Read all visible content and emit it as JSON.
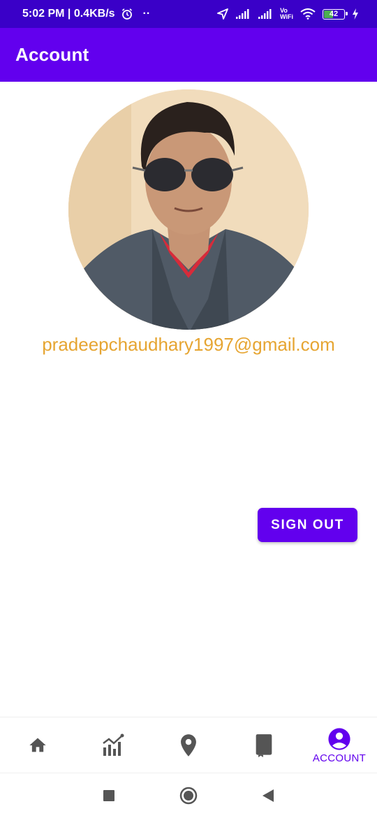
{
  "status_bar": {
    "time_speed": "5:02 PM | 0.4KB/s",
    "dots": "··",
    "battery": "42",
    "icons": [
      "alarm-icon",
      "navigation-icon",
      "signal-icon",
      "signal-icon",
      "vowifi-icon",
      "wifi-icon",
      "battery-icon",
      "charging-icon"
    ],
    "vowifi_label_top": "Vo",
    "vowifi_label_bottom": "WiFi"
  },
  "app_bar": {
    "title": "Account"
  },
  "profile": {
    "email": "pradeepchaudhary1997@gmail.com",
    "avatar_icon": "profile-photo"
  },
  "actions": {
    "sign_out_label": "SIGN OUT"
  },
  "bottom_nav": {
    "items": [
      {
        "icon": "home-icon",
        "label": ""
      },
      {
        "icon": "chart-icon",
        "label": ""
      },
      {
        "icon": "location-pin-icon",
        "label": ""
      },
      {
        "icon": "book-icon",
        "label": ""
      },
      {
        "icon": "account-icon",
        "label": "ACCOUNT",
        "selected": true
      }
    ]
  },
  "colors": {
    "primary": "#6200ee",
    "status_bar": "#3a00c8",
    "email_text": "#e6a532",
    "nav_inactive": "#555555"
  }
}
